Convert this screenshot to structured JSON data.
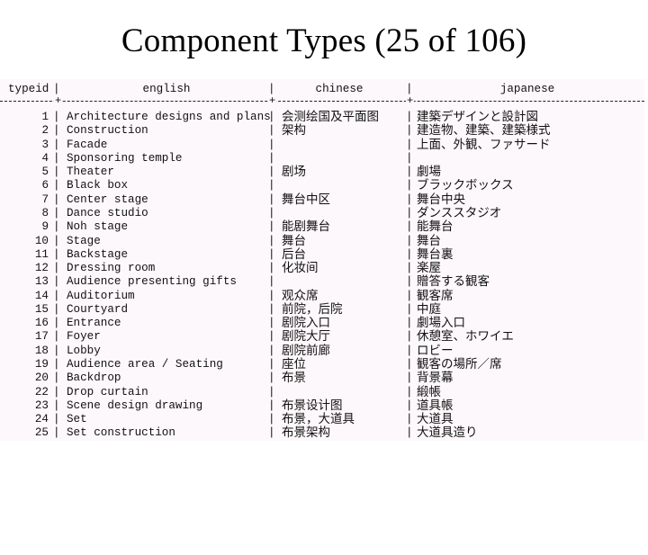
{
  "title": "Component Types (25 of 106)",
  "table": {
    "headers": {
      "typeid": "typeid",
      "english": "english",
      "chinese": "chinese",
      "japanese": "japanese"
    },
    "separator": "|",
    "rows": [
      {
        "typeid": "1",
        "english": "Architecture designs and plans",
        "chinese": "会测绘国及平面图",
        "japanese": "建築デザインと設計図"
      },
      {
        "typeid": "2",
        "english": "Construction",
        "chinese": "架构",
        "japanese": "建造物、建築、建築様式"
      },
      {
        "typeid": "3",
        "english": "Facade",
        "chinese": "",
        "japanese": "上面、外観、ファサード"
      },
      {
        "typeid": "4",
        "english": "Sponsoring temple",
        "chinese": "",
        "japanese": ""
      },
      {
        "typeid": "5",
        "english": "Theater",
        "chinese": "剧场",
        "japanese": "劇場"
      },
      {
        "typeid": "6",
        "english": "Black box",
        "chinese": "",
        "japanese": "ブラックボックス"
      },
      {
        "typeid": "7",
        "english": "Center stage",
        "chinese": "舞台中区",
        "japanese": "舞台中央"
      },
      {
        "typeid": "8",
        "english": "Dance studio",
        "chinese": "",
        "japanese": "ダンススタジオ"
      },
      {
        "typeid": "9",
        "english": "Noh stage",
        "chinese": "能剧舞台",
        "japanese": "能舞台"
      },
      {
        "typeid": "10",
        "english": "Stage",
        "chinese": "舞台",
        "japanese": "舞台"
      },
      {
        "typeid": "11",
        "english": "Backstage",
        "chinese": "后台",
        "japanese": "舞台裏"
      },
      {
        "typeid": "12",
        "english": "Dressing room",
        "chinese": "化妆间",
        "japanese": "楽屋"
      },
      {
        "typeid": "13",
        "english": "Audience presenting gifts",
        "chinese": "",
        "japanese": "贈答する観客"
      },
      {
        "typeid": "14",
        "english": "Auditorium",
        "chinese": "观众席",
        "japanese": "観客席"
      },
      {
        "typeid": "15",
        "english": "Courtyard",
        "chinese": "前院，后院",
        "japanese": "中庭"
      },
      {
        "typeid": "16",
        "english": "Entrance",
        "chinese": "剧院入口",
        "japanese": "劇場入口"
      },
      {
        "typeid": "17",
        "english": "Foyer",
        "chinese": "剧院大厅",
        "japanese": "休憩室、ホワイエ"
      },
      {
        "typeid": "18",
        "english": "Lobby",
        "chinese": "剧院前廊",
        "japanese": "ロビー"
      },
      {
        "typeid": "19",
        "english": "Audience area / Seating",
        "chinese": "座位",
        "japanese": "観客の場所／席"
      },
      {
        "typeid": "20",
        "english": "Backdrop",
        "chinese": "布景",
        "japanese": "背景幕"
      },
      {
        "typeid": "22",
        "english": "Drop curtain",
        "chinese": "",
        "japanese": "緞帳"
      },
      {
        "typeid": "23",
        "english": "Scene design drawing",
        "chinese": "布景设计图",
        "japanese": "道具帳"
      },
      {
        "typeid": "24",
        "english": "Set",
        "chinese": "布景，大道具",
        "japanese": "大道具"
      },
      {
        "typeid": "25",
        "english": "Set construction",
        "chinese": "布景架构",
        "japanese": "大道具造り"
      }
    ]
  }
}
